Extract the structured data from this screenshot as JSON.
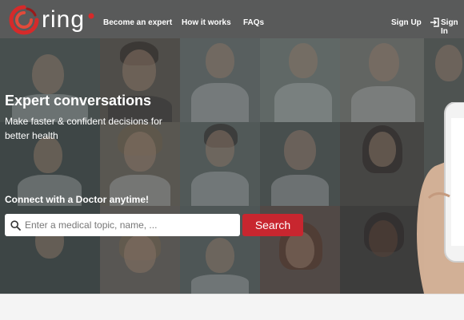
{
  "header": {
    "brand": "ring",
    "nav": [
      {
        "label": "Become an expert"
      },
      {
        "label": "How it works"
      },
      {
        "label": "FAQs"
      }
    ],
    "signup_label": "Sign Up",
    "signin_label": "Sign In"
  },
  "hero": {
    "title": "Expert conversations",
    "subtitle": "Make faster & confident decisions for better health",
    "connect": "Connect with a Doctor anytime!"
  },
  "search": {
    "placeholder": "Enter a medical topic, name, ...",
    "value": "",
    "button_label": "Search"
  },
  "colors": {
    "accent": "#c8262f",
    "overlay": "#3b3f3f"
  }
}
